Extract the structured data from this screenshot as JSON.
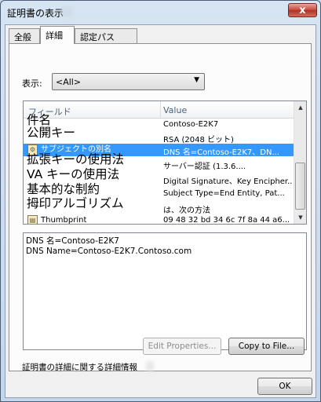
{
  "window": {
    "title": "証明書の表示"
  },
  "tabs": [
    {
      "label": "全般",
      "active": false
    },
    {
      "label": "詳細",
      "active": true
    },
    {
      "label": "認定パス",
      "active": false
    }
  ],
  "show": {
    "label": "表示:",
    "selected": "<All>"
  },
  "list": {
    "columns": [
      "フィールド",
      "Value"
    ],
    "rows": [
      {
        "field": "件名",
        "value": "Contoso-E2K7",
        "icon": "certificate-field-icon"
      },
      {
        "field": "公開キー",
        "value": "RSA (2048 ビット)",
        "icon": "certificate-field-icon"
      },
      {
        "field": "サブジェクトの別名",
        "value": "DNS 名=Contoso-E2K7、DN...",
        "icon": "certificate-extension-icon",
        "selected": true
      },
      {
        "field": "拡張キーの使用法",
        "value": "サーバー認証 (1.3.6....",
        "icon": "certificate-extension-icon"
      },
      {
        "field": "VA キーの使用法",
        "value": "Digital Signature、Key Encipher...",
        "icon": "certificate-extension-icon"
      },
      {
        "field": "基本的な制約",
        "value": "Subject Type=End Entity, Pat...",
        "icon": "certificate-extension-icon"
      },
      {
        "field": "拇印アルゴリズム",
        "value": "は、次の方法",
        "icon": "certificate-field-icon"
      },
      {
        "field": "Thumbprint",
        "value": "09 48 32 bd 34 6c 7f 8a 44 a6...",
        "icon": "certificate-field-icon"
      }
    ]
  },
  "detail": {
    "lines": [
      "DNS 名=Contoso-E2K7",
      "DNS Name=Contoso-E2K7.Contoso.com"
    ]
  },
  "buttons": {
    "edit_properties": "Edit Properties...",
    "copy_to_file": "Copy to File...",
    "ok": "OK",
    "close": "x"
  },
  "info": {
    "link": "証明書の詳細に関する詳細情報"
  }
}
